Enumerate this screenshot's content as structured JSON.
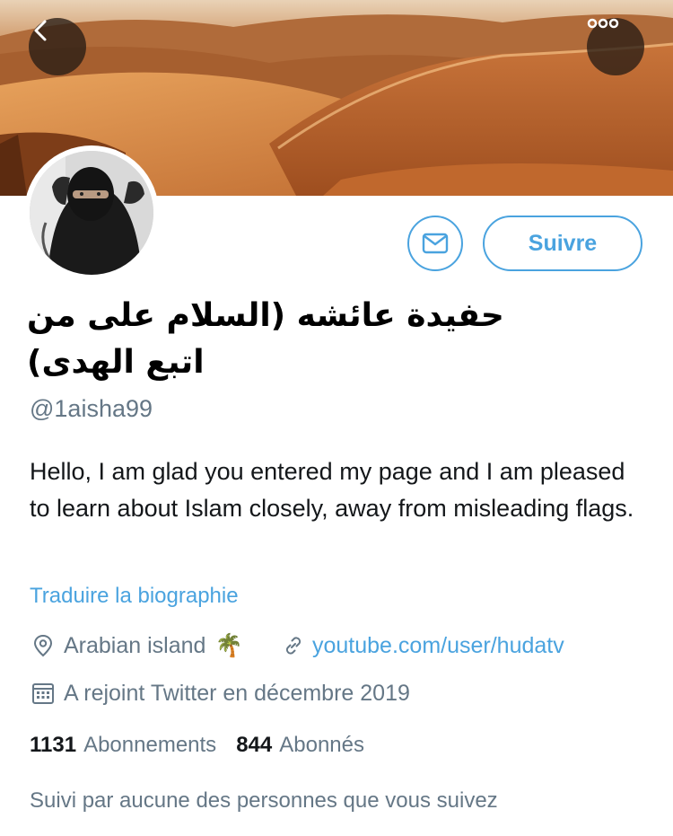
{
  "header": {
    "back_icon": "chevron-left-icon",
    "more_icon": "more-horizontal-icon"
  },
  "actions": {
    "message_icon": "mail-icon",
    "follow_label": "Suivre"
  },
  "profile": {
    "display_name": "حفيدة عائشه (السلام على من اتبع الهدى)",
    "handle": "@1aisha99",
    "bio": "Hello, I am glad you entered my page and I am pleased to learn about Islam closely, away from misleading flags.",
    "translate_label": "Traduire la biographie",
    "location": "Arabian island",
    "location_emoji": "🌴",
    "website": "youtube.com/user/hudatv",
    "joined": "A rejoint Twitter en décembre 2019",
    "following_count": "1131",
    "following_label": "Abonnements",
    "followers_count": "844",
    "followers_label": "Abonnés",
    "followed_by_text": "Suivi par aucune des personnes que vous suivez"
  },
  "colors": {
    "accent": "#4aa3df",
    "secondary_text": "#657786"
  }
}
